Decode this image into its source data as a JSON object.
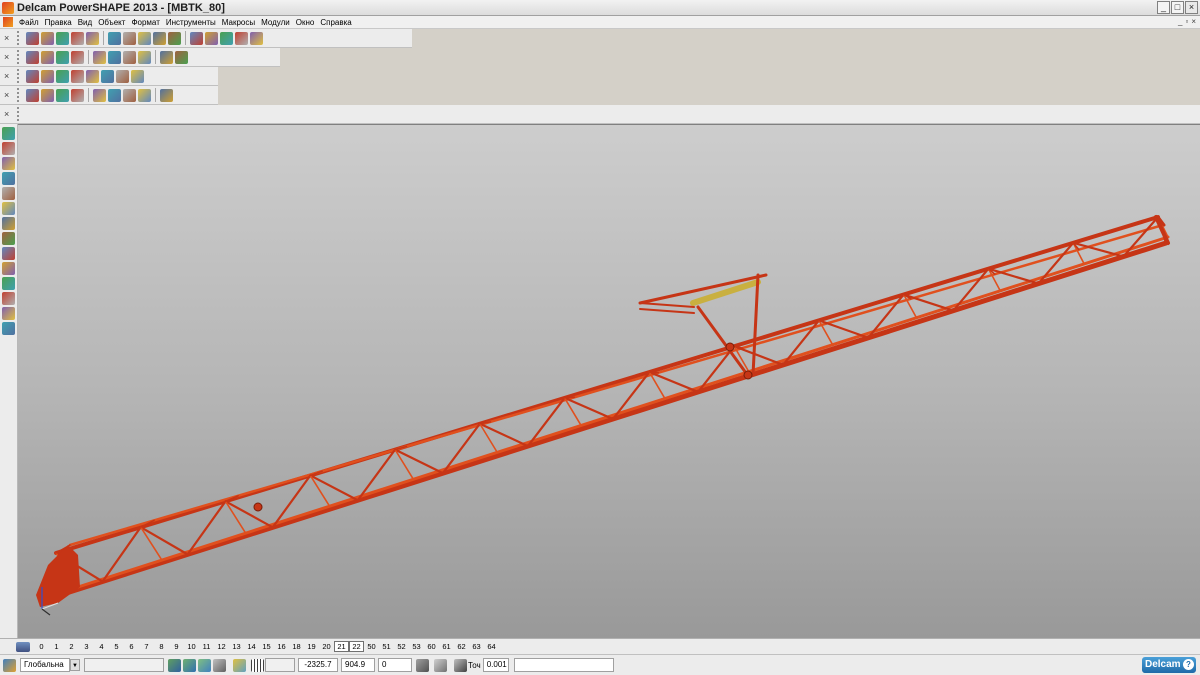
{
  "window": {
    "title": "Delcam PowerSHAPE 2013 - [MBTK_80]",
    "controls": [
      "_",
      "□",
      "×"
    ],
    "mdi_controls": [
      "_",
      "▫",
      "×"
    ]
  },
  "menu": [
    "Файл",
    "Правка",
    "Вид",
    "Объект",
    "Формат",
    "Инструменты",
    "Макросы",
    "Модули",
    "Окно",
    "Справка"
  ],
  "toolbars": {
    "main_icons": [
      "new-icon",
      "open-icon",
      "save-icon",
      "print-icon",
      "cut-icon",
      "copy-icon",
      "paste-icon",
      "delete-icon",
      "undo-icon",
      "redo-icon",
      "select-icon",
      "measure-icon",
      "circle-icon",
      "curve-icon",
      "text-icon"
    ],
    "view_icons": [
      "view-top-icon",
      "view-front-icon",
      "view-side-icon",
      "view-iso-icon",
      "zoom-in-icon",
      "zoom-out-icon",
      "zoom-fit-icon",
      "shade-icon",
      "wireframe-icon",
      "light-icon"
    ],
    "object_icons": [
      "surface-icon",
      "solid-icon",
      "sphere-icon",
      "cone-icon",
      "cylinder-icon",
      "block-icon",
      "feature-icon",
      "boolean-icon"
    ],
    "edit_icons": [
      "transform-icon",
      "mirror-icon",
      "scale-icon",
      "rotate-icon",
      "move-icon",
      "copy-object-icon",
      "align-icon",
      "group-icon",
      "assembly-icon"
    ]
  },
  "levels": [
    "0",
    "1",
    "2",
    "3",
    "4",
    "5",
    "6",
    "7",
    "8",
    "9",
    "10",
    "11",
    "12",
    "13",
    "14",
    "15",
    "16",
    "18",
    "19",
    "20",
    "21",
    "22",
    "50",
    "51",
    "52",
    "53",
    "60",
    "61",
    "62",
    "63",
    "64"
  ],
  "active_levels": [
    "21",
    "22"
  ],
  "status": {
    "workplane": "Глобальна",
    "x": "-2325.7",
    "y": "904.9",
    "z": "0",
    "tolerance_label": "Точ",
    "tolerance": "0.001",
    "logo": "Delcam",
    "help": "?"
  },
  "model": {
    "color": "#c63516",
    "highlight": "#e0501e",
    "accent": "#c9b040"
  }
}
